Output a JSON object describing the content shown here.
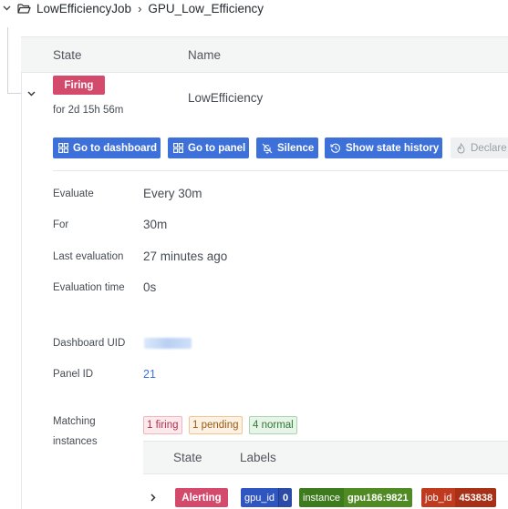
{
  "breadcrumb": {
    "folder": "LowEfficiencyJob",
    "separator": "›",
    "group": "GPU_Low_Efficiency"
  },
  "rules_table": {
    "columns": {
      "state": "State",
      "name": "Name"
    }
  },
  "rule": {
    "state_badge": "Firing",
    "duration": "for 2d 15h 56m",
    "name": "LowEfficiency",
    "state_color": "#d44a6c"
  },
  "actions": {
    "go_to_dashboard": "Go to dashboard",
    "go_to_panel": "Go to panel",
    "silence": "Silence",
    "show_state_history": "Show state history",
    "declare": "Declare",
    "accent_color": "#3d71d9"
  },
  "details": {
    "evaluate": {
      "label": "Evaluate",
      "value": "Every 30m"
    },
    "for": {
      "label": "For",
      "value": "30m"
    },
    "last_evaluation": {
      "label": "Last evaluation",
      "value": "27 minutes ago"
    },
    "evaluation_time": {
      "label": "Evaluation time",
      "value": "0s"
    },
    "dashboard_uid": {
      "label": "Dashboard UID"
    },
    "panel_id": {
      "label": "Panel ID",
      "value": "21"
    }
  },
  "matching": {
    "label_line1": "Matching",
    "label_line2": "instances",
    "firing": "1 firing",
    "pending": "1 pending",
    "normal": "4 normal"
  },
  "instances_table": {
    "columns": {
      "state": "State",
      "labels": "Labels"
    },
    "rows": [
      {
        "state": "Alerting",
        "labels": [
          {
            "key": "gpu_id",
            "value": "0",
            "color": "#2f55c0"
          },
          {
            "key": "instance",
            "value": "gpu186:9821",
            "color": "#3e7a1e"
          },
          {
            "key": "job_id",
            "value": "453838",
            "color": "#c03a1f"
          }
        ]
      }
    ]
  },
  "icons": {
    "breadcrumb_toggle": "chevron-down-icon",
    "folder": "folder-open-icon",
    "row_toggle": "chevron-down-icon",
    "dashboard": "apps-icon",
    "panel": "apps-icon",
    "silence": "bell-slash-icon",
    "history": "history-icon",
    "declare": "fire-icon",
    "instance_toggle": "chevron-right-icon"
  }
}
